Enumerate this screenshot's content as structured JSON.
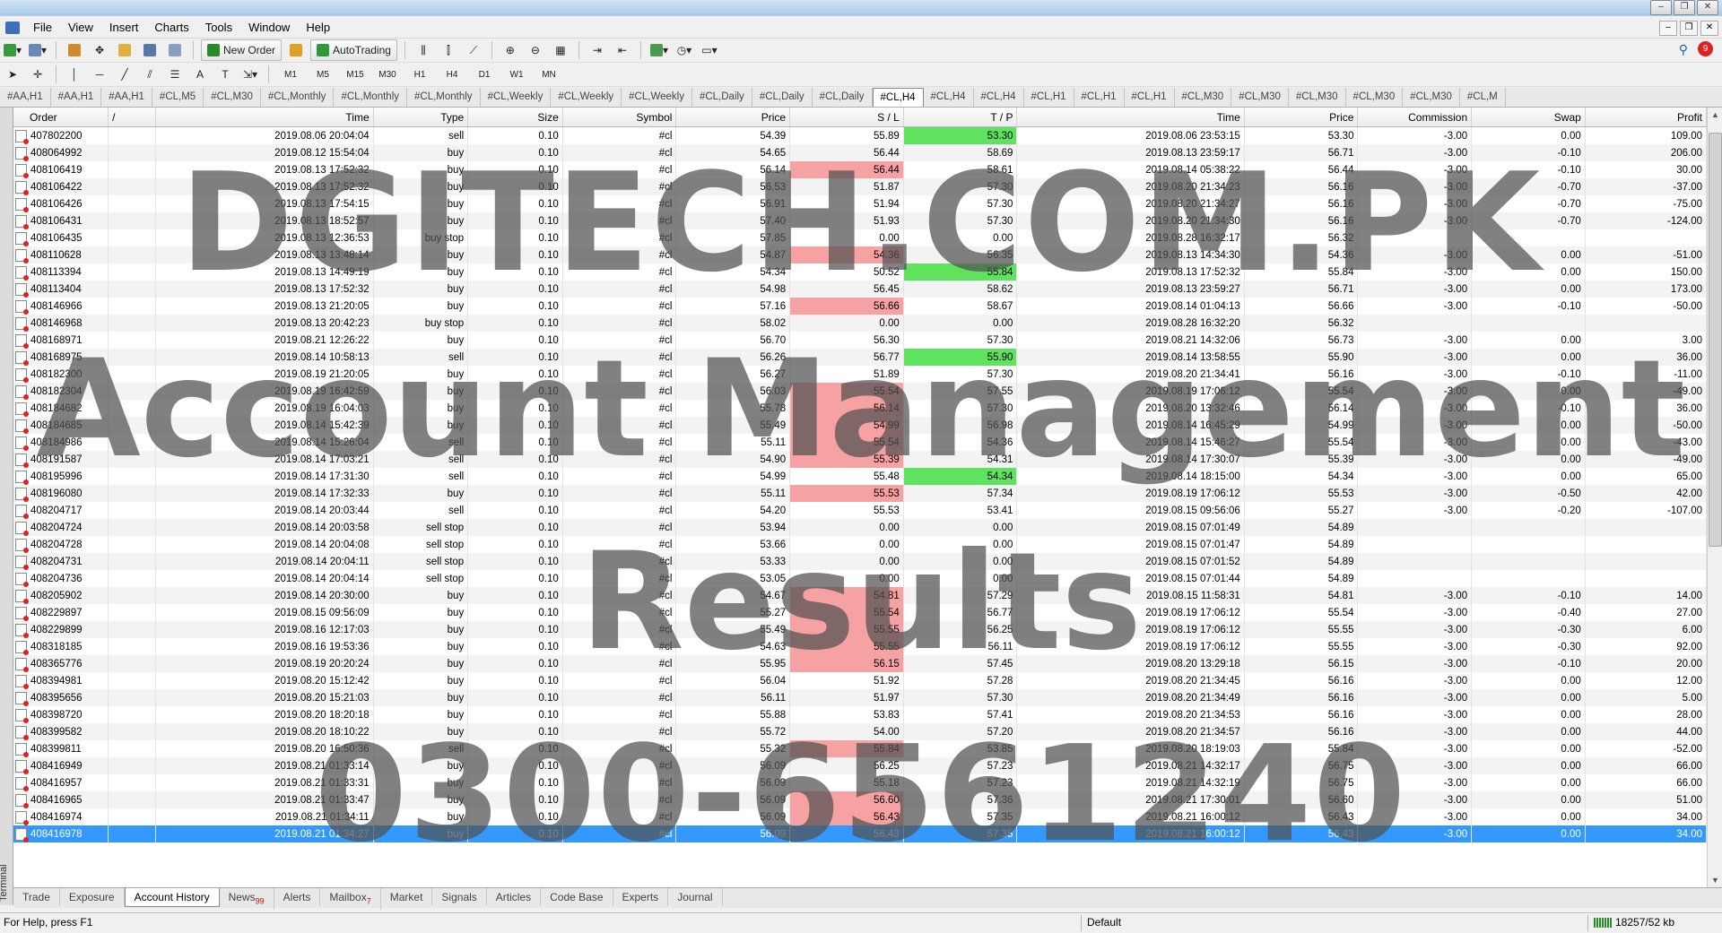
{
  "menu": [
    "File",
    "View",
    "Insert",
    "Charts",
    "Tools",
    "Window",
    "Help"
  ],
  "toolbar": {
    "new_order": "New Order",
    "autotrading": "AutoTrading",
    "timeframes": [
      "M1",
      "M5",
      "M15",
      "M30",
      "H1",
      "H4",
      "D1",
      "W1",
      "MN"
    ],
    "notification_count": "9"
  },
  "chart_tabs": [
    "#AA,H1",
    "#AA,H1",
    "#AA,H1",
    "#CL,M5",
    "#CL,M30",
    "#CL,Monthly",
    "#CL,Monthly",
    "#CL,Monthly",
    "#CL,Weekly",
    "#CL,Weekly",
    "#CL,Weekly",
    "#CL,Daily",
    "#CL,Daily",
    "#CL,Daily",
    "#CL,H4",
    "#CL,H4",
    "#CL,H4",
    "#CL,H1",
    "#CL,H1",
    "#CL,H1",
    "#CL,M30",
    "#CL,M30",
    "#CL,M30",
    "#CL,M30",
    "#CL,M30",
    "#CL,M"
  ],
  "active_chart_tab": 14,
  "columns": [
    "Order",
    "/",
    "Time",
    "Type",
    "Size",
    "Symbol",
    "Price",
    "S / L",
    "T / P",
    "Time",
    "Price",
    "Commission",
    "Swap",
    "Profit"
  ],
  "rows": [
    {
      "order": "407802200",
      "time": "2019.08.06 20:04:04",
      "type": "sell",
      "size": "0.10",
      "symbol": "#cl",
      "price": "54.39",
      "sl": "55.89",
      "tp": "53.30",
      "ctime": "2019.08.06 23:53:15",
      "cprice": "53.30",
      "comm": "-3.00",
      "swap": "0.00",
      "profit": "109.00",
      "hl": "tp"
    },
    {
      "order": "408064992",
      "time": "2019.08.12 15:54:04",
      "type": "buy",
      "size": "0.10",
      "symbol": "#cl",
      "price": "54.65",
      "sl": "56.44",
      "tp": "58.69",
      "ctime": "2019.08.13 23:59:17",
      "cprice": "56.71",
      "comm": "-3.00",
      "swap": "-0.10",
      "profit": "206.00",
      "hl": ""
    },
    {
      "order": "408106419",
      "time": "2019.08.13 17:52:32",
      "type": "buy",
      "size": "0.10",
      "symbol": "#cl",
      "price": "56.14",
      "sl": "56.44",
      "tp": "58.61",
      "ctime": "2019.08.14 05:38:22",
      "cprice": "56.44",
      "comm": "-3.00",
      "swap": "-0.10",
      "profit": "30.00",
      "hl": "sl"
    },
    {
      "order": "408106422",
      "time": "2019.08.13 17:52:32",
      "type": "buy",
      "size": "0.10",
      "symbol": "#cl",
      "price": "56.53",
      "sl": "51.87",
      "tp": "57.30",
      "ctime": "2019.08.20 21:34:23",
      "cprice": "56.16",
      "comm": "-3.00",
      "swap": "-0.70",
      "profit": "-37.00",
      "hl": ""
    },
    {
      "order": "408106426",
      "time": "2019.08.13 17:54:15",
      "type": "buy",
      "size": "0.10",
      "symbol": "#cl",
      "price": "56.91",
      "sl": "51.94",
      "tp": "57.30",
      "ctime": "2019.08.20 21:34:27",
      "cprice": "56.16",
      "comm": "-3.00",
      "swap": "-0.70",
      "profit": "-75.00",
      "hl": ""
    },
    {
      "order": "408106431",
      "time": "2019.08.13 18:52:57",
      "type": "buy",
      "size": "0.10",
      "symbol": "#cl",
      "price": "57.40",
      "sl": "51.93",
      "tp": "57.30",
      "ctime": "2019.08.20 21:34:30",
      "cprice": "56.16",
      "comm": "-3.00",
      "swap": "-0.70",
      "profit": "-124.00",
      "hl": ""
    },
    {
      "order": "408106435",
      "time": "2019.08.13 12:36:53",
      "type": "buy stop",
      "size": "0.10",
      "symbol": "#cl",
      "price": "57.85",
      "sl": "0.00",
      "tp": "0.00",
      "ctime": "2019.08.28 16:32:17",
      "cprice": "56.32",
      "comm": "",
      "swap": "",
      "profit": "",
      "hl": ""
    },
    {
      "order": "408110628",
      "time": "2019.08.13 13:48:14",
      "type": "buy",
      "size": "0.10",
      "symbol": "#cl",
      "price": "54.87",
      "sl": "54.36",
      "tp": "56.35",
      "ctime": "2019.08.13 14:34:30",
      "cprice": "54.36",
      "comm": "-3.00",
      "swap": "0.00",
      "profit": "-51.00",
      "hl": "sl"
    },
    {
      "order": "408113394",
      "time": "2019.08.13 14:49:19",
      "type": "buy",
      "size": "0.10",
      "symbol": "#cl",
      "price": "54.34",
      "sl": "50.52",
      "tp": "55.84",
      "ctime": "2019.08.13 17:52:32",
      "cprice": "55.84",
      "comm": "-3.00",
      "swap": "0.00",
      "profit": "150.00",
      "hl": "tp"
    },
    {
      "order": "408113404",
      "time": "2019.08.13 17:52:32",
      "type": "buy",
      "size": "0.10",
      "symbol": "#cl",
      "price": "54.98",
      "sl": "56.45",
      "tp": "58.62",
      "ctime": "2019.08.13 23:59:27",
      "cprice": "56.71",
      "comm": "-3.00",
      "swap": "0.00",
      "profit": "173.00",
      "hl": ""
    },
    {
      "order": "408146966",
      "time": "2019.08.13 21:20:05",
      "type": "buy",
      "size": "0.10",
      "symbol": "#cl",
      "price": "57.16",
      "sl": "56.66",
      "tp": "58.67",
      "ctime": "2019.08.14 01:04:13",
      "cprice": "56.66",
      "comm": "-3.00",
      "swap": "-0.10",
      "profit": "-50.00",
      "hl": "sl"
    },
    {
      "order": "408146968",
      "time": "2019.08.13 20:42:23",
      "type": "buy stop",
      "size": "0.10",
      "symbol": "#cl",
      "price": "58.02",
      "sl": "0.00",
      "tp": "0.00",
      "ctime": "2019.08.28 16:32:20",
      "cprice": "56.32",
      "comm": "",
      "swap": "",
      "profit": "",
      "hl": ""
    },
    {
      "order": "408168971",
      "time": "2019.08.21 12:26:22",
      "type": "buy",
      "size": "0.10",
      "symbol": "#cl",
      "price": "56.70",
      "sl": "56.30",
      "tp": "57.30",
      "ctime": "2019.08.21 14:32:06",
      "cprice": "56.73",
      "comm": "-3.00",
      "swap": "0.00",
      "profit": "3.00",
      "hl": ""
    },
    {
      "order": "408168975",
      "time": "2019.08.14 10:58:13",
      "type": "sell",
      "size": "0.10",
      "symbol": "#cl",
      "price": "56.26",
      "sl": "56.77",
      "tp": "55.90",
      "ctime": "2019.08.14 13:58:55",
      "cprice": "55.90",
      "comm": "-3.00",
      "swap": "0.00",
      "profit": "36.00",
      "hl": "tp"
    },
    {
      "order": "408182300",
      "time": "2019.08.19 21:20:05",
      "type": "buy",
      "size": "0.10",
      "symbol": "#cl",
      "price": "56.27",
      "sl": "51.89",
      "tp": "57.30",
      "ctime": "2019.08.20 21:34:41",
      "cprice": "56.16",
      "comm": "-3.00",
      "swap": "-0.10",
      "profit": "-11.00",
      "hl": ""
    },
    {
      "order": "408182304",
      "time": "2019.08.19 16:42:59",
      "type": "buy",
      "size": "0.10",
      "symbol": "#cl",
      "price": "56.03",
      "sl": "55.54",
      "tp": "57.55",
      "ctime": "2019.08.19 17:06:12",
      "cprice": "55.54",
      "comm": "-3.00",
      "swap": "0.00",
      "profit": "-49.00",
      "hl": "sl"
    },
    {
      "order": "408184682",
      "time": "2019.08.19 16:04:03",
      "type": "buy",
      "size": "0.10",
      "symbol": "#cl",
      "price": "55.78",
      "sl": "56.14",
      "tp": "57.30",
      "ctime": "2019.08.20 13:32:46",
      "cprice": "56.14",
      "comm": "-3.00",
      "swap": "-0.10",
      "profit": "36.00",
      "hl": "sl"
    },
    {
      "order": "408184685",
      "time": "2019.08.14 15:42:39",
      "type": "buy",
      "size": "0.10",
      "symbol": "#cl",
      "price": "55.49",
      "sl": "54.99",
      "tp": "56.98",
      "ctime": "2019.08.14 16:45:29",
      "cprice": "54.99",
      "comm": "-3.00",
      "swap": "0.00",
      "profit": "-50.00",
      "hl": "sl"
    },
    {
      "order": "408184986",
      "time": "2019.08.14 15:26:04",
      "type": "sell",
      "size": "0.10",
      "symbol": "#cl",
      "price": "55.11",
      "sl": "55.54",
      "tp": "54.36",
      "ctime": "2019.08.14 15:46:27",
      "cprice": "55.54",
      "comm": "-3.00",
      "swap": "0.00",
      "profit": "-43.00",
      "hl": "sl"
    },
    {
      "order": "408191587",
      "time": "2019.08.14 17:03:21",
      "type": "sell",
      "size": "0.10",
      "symbol": "#cl",
      "price": "54.90",
      "sl": "55.39",
      "tp": "54.31",
      "ctime": "2019.08.14 17:30:07",
      "cprice": "55.39",
      "comm": "-3.00",
      "swap": "0.00",
      "profit": "-49.00",
      "hl": "sl"
    },
    {
      "order": "408195996",
      "time": "2019.08.14 17:31:30",
      "type": "sell",
      "size": "0.10",
      "symbol": "#cl",
      "price": "54.99",
      "sl": "55.48",
      "tp": "54.34",
      "ctime": "2019.08.14 18:15:00",
      "cprice": "54.34",
      "comm": "-3.00",
      "swap": "0.00",
      "profit": "65.00",
      "hl": "tp"
    },
    {
      "order": "408196080",
      "time": "2019.08.14 17:32:33",
      "type": "buy",
      "size": "0.10",
      "symbol": "#cl",
      "price": "55.11",
      "sl": "55.53",
      "tp": "57.34",
      "ctime": "2019.08.19 17:06:12",
      "cprice": "55.53",
      "comm": "-3.00",
      "swap": "-0.50",
      "profit": "42.00",
      "hl": "sl"
    },
    {
      "order": "408204717",
      "time": "2019.08.14 20:03:44",
      "type": "sell",
      "size": "0.10",
      "symbol": "#cl",
      "price": "54.20",
      "sl": "55.53",
      "tp": "53.41",
      "ctime": "2019.08.15 09:56:06",
      "cprice": "55.27",
      "comm": "-3.00",
      "swap": "-0.20",
      "profit": "-107.00",
      "hl": ""
    },
    {
      "order": "408204724",
      "time": "2019.08.14 20:03:58",
      "type": "sell stop",
      "size": "0.10",
      "symbol": "#cl",
      "price": "53.94",
      "sl": "0.00",
      "tp": "0.00",
      "ctime": "2019.08.15 07:01:49",
      "cprice": "54.89",
      "comm": "",
      "swap": "",
      "profit": "",
      "hl": ""
    },
    {
      "order": "408204728",
      "time": "2019.08.14 20:04:08",
      "type": "sell stop",
      "size": "0.10",
      "symbol": "#cl",
      "price": "53.66",
      "sl": "0.00",
      "tp": "0.00",
      "ctime": "2019.08.15 07:01:47",
      "cprice": "54.89",
      "comm": "",
      "swap": "",
      "profit": "",
      "hl": ""
    },
    {
      "order": "408204731",
      "time": "2019.08.14 20:04:11",
      "type": "sell stop",
      "size": "0.10",
      "symbol": "#cl",
      "price": "53.33",
      "sl": "0.00",
      "tp": "0.00",
      "ctime": "2019.08.15 07:01:52",
      "cprice": "54.89",
      "comm": "",
      "swap": "",
      "profit": "",
      "hl": ""
    },
    {
      "order": "408204736",
      "time": "2019.08.14 20:04:14",
      "type": "sell stop",
      "size": "0.10",
      "symbol": "#cl",
      "price": "53.05",
      "sl": "0.00",
      "tp": "0.00",
      "ctime": "2019.08.15 07:01:44",
      "cprice": "54.89",
      "comm": "",
      "swap": "",
      "profit": "",
      "hl": ""
    },
    {
      "order": "408205902",
      "time": "2019.08.14 20:30:00",
      "type": "buy",
      "size": "0.10",
      "symbol": "#cl",
      "price": "54.67",
      "sl": "54.81",
      "tp": "57.29",
      "ctime": "2019.08.15 11:58:31",
      "cprice": "54.81",
      "comm": "-3.00",
      "swap": "-0.10",
      "profit": "14.00",
      "hl": "sl"
    },
    {
      "order": "408229897",
      "time": "2019.08.15 09:56:09",
      "type": "buy",
      "size": "0.10",
      "symbol": "#cl",
      "price": "55.27",
      "sl": "55.54",
      "tp": "56.77",
      "ctime": "2019.08.19 17:06:12",
      "cprice": "55.54",
      "comm": "-3.00",
      "swap": "-0.40",
      "profit": "27.00",
      "hl": "sl"
    },
    {
      "order": "408229899",
      "time": "2019.08.16 12:17:03",
      "type": "buy",
      "size": "0.10",
      "symbol": "#cl",
      "price": "55.49",
      "sl": "55.55",
      "tp": "56.25",
      "ctime": "2019.08.19 17:06:12",
      "cprice": "55.55",
      "comm": "-3.00",
      "swap": "-0.30",
      "profit": "6.00",
      "hl": "sl"
    },
    {
      "order": "408318185",
      "time": "2019.08.16 19:53:36",
      "type": "buy",
      "size": "0.10",
      "symbol": "#cl",
      "price": "54.63",
      "sl": "55.55",
      "tp": "56.11",
      "ctime": "2019.08.19 17:06:12",
      "cprice": "55.55",
      "comm": "-3.00",
      "swap": "-0.30",
      "profit": "92.00",
      "hl": "sl"
    },
    {
      "order": "408365776",
      "time": "2019.08.19 20:20:24",
      "type": "buy",
      "size": "0.10",
      "symbol": "#cl",
      "price": "55.95",
      "sl": "56.15",
      "tp": "57.45",
      "ctime": "2019.08.20 13:29:18",
      "cprice": "56.15",
      "comm": "-3.00",
      "swap": "-0.10",
      "profit": "20.00",
      "hl": "sl"
    },
    {
      "order": "408394981",
      "time": "2019.08.20 15:12:42",
      "type": "buy",
      "size": "0.10",
      "symbol": "#cl",
      "price": "56.04",
      "sl": "51.92",
      "tp": "57.28",
      "ctime": "2019.08.20 21:34:45",
      "cprice": "56.16",
      "comm": "-3.00",
      "swap": "0.00",
      "profit": "12.00",
      "hl": ""
    },
    {
      "order": "408395656",
      "time": "2019.08.20 15:21:03",
      "type": "buy",
      "size": "0.10",
      "symbol": "#cl",
      "price": "56.11",
      "sl": "51.97",
      "tp": "57.30",
      "ctime": "2019.08.20 21:34:49",
      "cprice": "56.16",
      "comm": "-3.00",
      "swap": "0.00",
      "profit": "5.00",
      "hl": ""
    },
    {
      "order": "408398720",
      "time": "2019.08.20 18:20:18",
      "type": "buy",
      "size": "0.10",
      "symbol": "#cl",
      "price": "55.88",
      "sl": "53.83",
      "tp": "57.41",
      "ctime": "2019.08.20 21:34:53",
      "cprice": "56.16",
      "comm": "-3.00",
      "swap": "0.00",
      "profit": "28.00",
      "hl": ""
    },
    {
      "order": "408399582",
      "time": "2019.08.20 18:10:22",
      "type": "buy",
      "size": "0.10",
      "symbol": "#cl",
      "price": "55.72",
      "sl": "54.00",
      "tp": "57.20",
      "ctime": "2019.08.20 21:34:57",
      "cprice": "56.16",
      "comm": "-3.00",
      "swap": "0.00",
      "profit": "44.00",
      "hl": ""
    },
    {
      "order": "408399811",
      "time": "2019.08.20 16:50:36",
      "type": "sell",
      "size": "0.10",
      "symbol": "#cl",
      "price": "55.32",
      "sl": "55.84",
      "tp": "53.85",
      "ctime": "2019.08.20 18:19:03",
      "cprice": "55.84",
      "comm": "-3.00",
      "swap": "0.00",
      "profit": "-52.00",
      "hl": "sl"
    },
    {
      "order": "408416949",
      "time": "2019.08.21 01:33:14",
      "type": "buy",
      "size": "0.10",
      "symbol": "#cl",
      "price": "56.09",
      "sl": "56.25",
      "tp": "57.23",
      "ctime": "2019.08.21 14:32:17",
      "cprice": "56.75",
      "comm": "-3.00",
      "swap": "0.00",
      "profit": "66.00",
      "hl": ""
    },
    {
      "order": "408416957",
      "time": "2019.08.21 01:33:31",
      "type": "buy",
      "size": "0.10",
      "symbol": "#cl",
      "price": "56.09",
      "sl": "55.18",
      "tp": "57.23",
      "ctime": "2019.08.21 14:32:19",
      "cprice": "56.75",
      "comm": "-3.00",
      "swap": "0.00",
      "profit": "66.00",
      "hl": ""
    },
    {
      "order": "408416965",
      "time": "2019.08.21 01:33:47",
      "type": "buy",
      "size": "0.10",
      "symbol": "#cl",
      "price": "56.09",
      "sl": "56.60",
      "tp": "57.36",
      "ctime": "2019.08.21 17:30:01",
      "cprice": "56.60",
      "comm": "-3.00",
      "swap": "0.00",
      "profit": "51.00",
      "hl": "sl"
    },
    {
      "order": "408416974",
      "time": "2019.08.21 01:34:11",
      "type": "buy",
      "size": "0.10",
      "symbol": "#cl",
      "price": "56.09",
      "sl": "56.43",
      "tp": "57.35",
      "ctime": "2019.08.21 16:00:12",
      "cprice": "56.43",
      "comm": "-3.00",
      "swap": "0.00",
      "profit": "34.00",
      "hl": "sl"
    },
    {
      "order": "408416978",
      "time": "2019.08.21 01:34:27",
      "type": "buy",
      "size": "0.10",
      "symbol": "#cl",
      "price": "56.09",
      "sl": "56.43",
      "tp": "57.35",
      "ctime": "2019.08.21 16:00:12",
      "cprice": "56.43",
      "comm": "-3.00",
      "swap": "0.00",
      "profit": "34.00",
      "hl": "sl",
      "selected": true
    }
  ],
  "bottom_tabs": [
    {
      "label": "Trade",
      "badge": ""
    },
    {
      "label": "Exposure",
      "badge": ""
    },
    {
      "label": "Account History",
      "badge": ""
    },
    {
      "label": "News",
      "badge": "99"
    },
    {
      "label": "Alerts",
      "badge": ""
    },
    {
      "label": "Mailbox",
      "badge": "7"
    },
    {
      "label": "Market",
      "badge": ""
    },
    {
      "label": "Signals",
      "badge": ""
    },
    {
      "label": "Articles",
      "badge": ""
    },
    {
      "label": "Code Base",
      "badge": ""
    },
    {
      "label": "Experts",
      "badge": ""
    },
    {
      "label": "Journal",
      "badge": ""
    }
  ],
  "active_bottom_tab": 2,
  "terminal_label": "Terminal",
  "status": {
    "help": "For Help, press F1",
    "profile": "Default",
    "traffic": "18257/52 kb"
  },
  "watermark": [
    "DGITECH.COM.PK",
    "Account Management",
    "Results",
    "0300-6561240"
  ],
  "colors": {
    "sl_hit": "#f7a2a2",
    "tp_hit": "#5fe35f",
    "selection": "#3399ff"
  }
}
